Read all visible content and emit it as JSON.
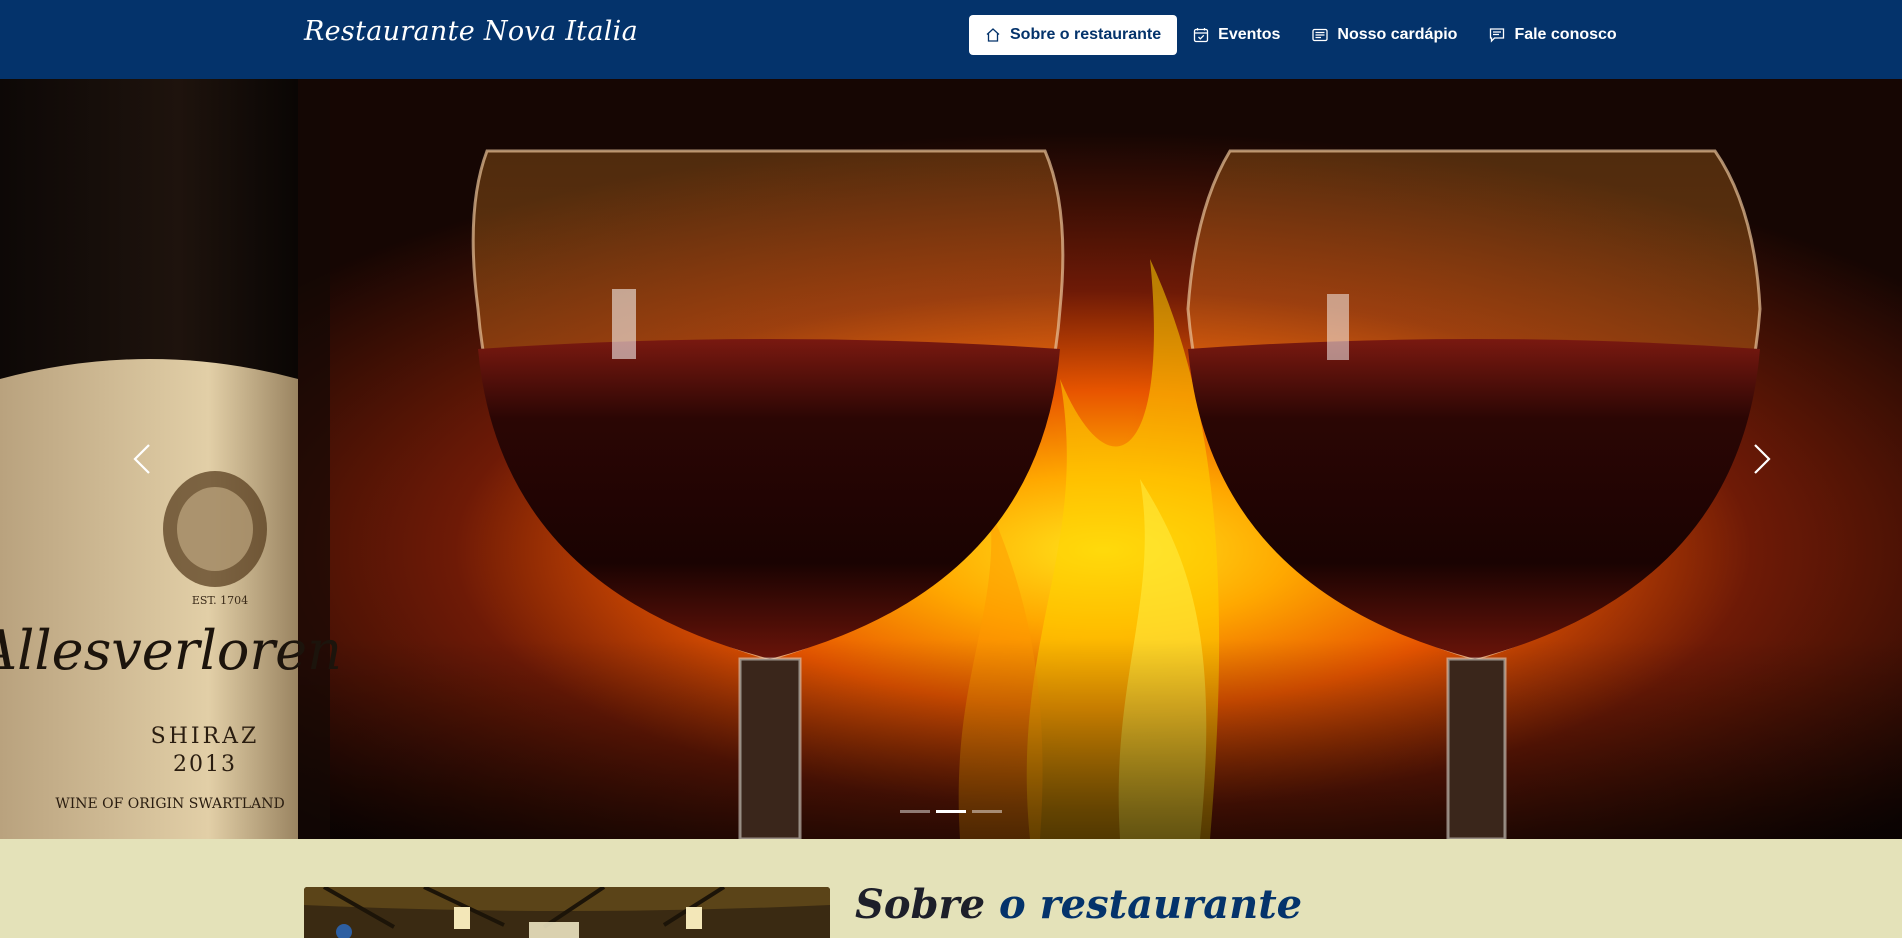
{
  "navbar": {
    "brand": "Restaurante Nova Italia",
    "items": [
      {
        "label": "Sobre o restaurante",
        "icon": "home-icon",
        "active": true
      },
      {
        "label": "Eventos",
        "icon": "calendar-check-icon",
        "active": false
      },
      {
        "label": "Nosso cardápio",
        "icon": "card-text-icon",
        "active": false
      },
      {
        "label": "Fale conosco",
        "icon": "chat-text-icon",
        "active": false
      }
    ]
  },
  "carousel": {
    "slide_count": 3,
    "active_index": 1,
    "image_description": "Two glasses of red wine and a Shiraz wine bottle in front of a fireplace",
    "bottle_label": {
      "est": "EST. 1704",
      "brand": "Allesverloren",
      "variety": "SHIRAZ",
      "year": "2013",
      "origin": "WINE OF ORIGIN SWARTLAND"
    }
  },
  "about": {
    "title_part1": "Sobre",
    "title_part2": "o restaurante"
  },
  "colors": {
    "navbar_bg": "#04336b",
    "page_bg": "#e4e2b9",
    "accent": "#04336b"
  }
}
